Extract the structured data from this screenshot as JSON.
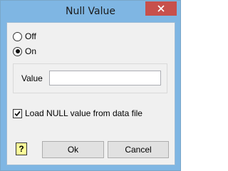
{
  "window": {
    "title": "Null Value"
  },
  "mode": {
    "options": [
      {
        "label": "Off",
        "selected": false
      },
      {
        "label": "On",
        "selected": true
      }
    ]
  },
  "value_field": {
    "label": "Value",
    "value": ""
  },
  "load_from_file": {
    "label": "Load NULL value from data file",
    "checked": true
  },
  "buttons": {
    "help": "?",
    "ok": "Ok",
    "cancel": "Cancel"
  },
  "icons": {
    "close": "close-icon",
    "check": "checkmark-icon",
    "help": "help-icon"
  }
}
